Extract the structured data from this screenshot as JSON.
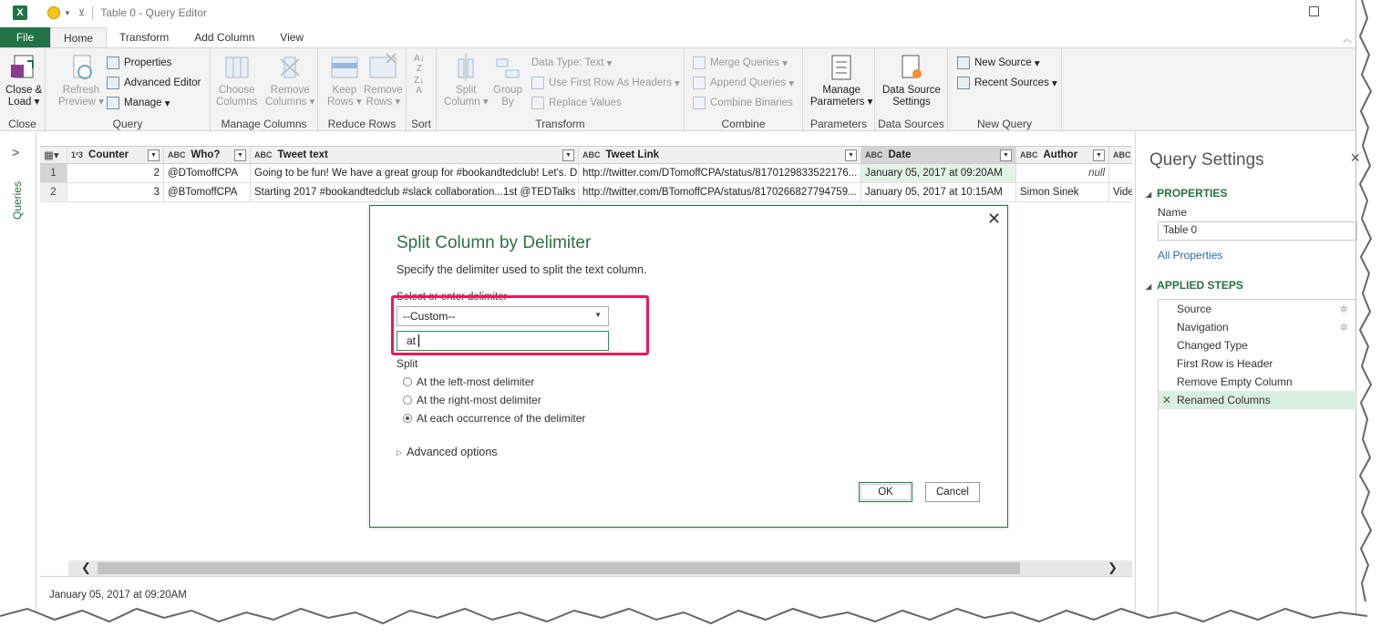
{
  "window": {
    "title": "Table 0 - Query Editor"
  },
  "ribbon_tabs": [
    {
      "label": "File"
    },
    {
      "label": "Home"
    },
    {
      "label": "Transform"
    },
    {
      "label": "Add Column"
    },
    {
      "label": "View"
    }
  ],
  "ribbon": {
    "close": {
      "btn": "Close &",
      "btn2": "Load",
      "label": "Close"
    },
    "query": {
      "refresh": "Refresh",
      "refresh2": "Preview",
      "properties": "Properties",
      "advanced_editor": "Advanced Editor",
      "manage": "Manage",
      "label": "Query"
    },
    "manage_columns": {
      "choose": "Choose",
      "choose2": "Columns",
      "remove": "Remove",
      "remove2": "Columns",
      "label": "Manage Columns"
    },
    "reduce_rows": {
      "keep": "Keep",
      "keep2": "Rows",
      "remove": "Remove",
      "remove2": "Rows",
      "label": "Reduce Rows"
    },
    "sort": {
      "label": "Sort"
    },
    "transform": {
      "split": "Split",
      "split2": "Column",
      "group": "Group",
      "group2": "By",
      "data_type": "Data Type: Text",
      "first_row": "Use First Row As Headers",
      "replace": "Replace Values",
      "label": "Transform"
    },
    "combine": {
      "merge": "Merge Queries",
      "append": "Append Queries",
      "binaries": "Combine Binaries",
      "label": "Combine"
    },
    "parameters": {
      "manage": "Manage",
      "manage2": "Parameters",
      "label": "Parameters"
    },
    "data_sources": {
      "btn": "Data Source",
      "btn2": "Settings",
      "label": "Data Sources"
    },
    "new_query": {
      "new_source": "New Source",
      "recent": "Recent Sources",
      "label": "New Query"
    }
  },
  "queries_pane": {
    "label": "Queries"
  },
  "grid": {
    "columns": [
      {
        "type": "1²3",
        "name": "Counter"
      },
      {
        "type": "ABC",
        "name": "Who?"
      },
      {
        "type": "ABC",
        "name": "Tweet text"
      },
      {
        "type": "ABC",
        "name": "Tweet Link"
      },
      {
        "type": "ABC",
        "name": "Date"
      },
      {
        "type": "ABC",
        "name": "Author"
      },
      {
        "type": "ABC",
        "name": ""
      }
    ],
    "rows": [
      {
        "n": "1",
        "counter": "2",
        "who": "@DTomoffCPA",
        "text": "Going to be fun! We have a great group for #bookandtedclub! Let's. D...",
        "link": "http://twitter.com/DTomoffCPA/status/8170129833522176...",
        "date": "January 05, 2017 at 09:20AM",
        "author": "null",
        "extra": ""
      },
      {
        "n": "2",
        "counter": "3",
        "who": "@BTomoffCPA",
        "text": "Starting 2017 #bookandtedclub #slack collaboration...1st @TEDTalks ...",
        "link": "http://twitter.com/BTomoffCPA/status/8170266827794759...",
        "date": "January 05, 2017 at 10:15AM",
        "author": "Simon Sinek",
        "extra": "Vide"
      }
    ]
  },
  "status": {
    "text": "January 05, 2017 at 09:20AM"
  },
  "query_settings": {
    "title": "Query Settings",
    "properties_heading": "PROPERTIES",
    "name_label": "Name",
    "name_value": "Table 0",
    "all_properties": "All Properties",
    "steps_heading": "APPLIED STEPS",
    "steps": [
      {
        "label": "Source"
      },
      {
        "label": "Navigation"
      },
      {
        "label": "Changed Type"
      },
      {
        "label": "First Row is Header"
      },
      {
        "label": "Remove Empty Column"
      },
      {
        "label": "Renamed Columns"
      }
    ]
  },
  "dialog": {
    "title": "Split Column by Delimiter",
    "description": "Specify the delimiter used to split the text column.",
    "delimiter_label": "Select or enter delimiter",
    "delimiter_selected": "--Custom--",
    "custom_value": "at",
    "split_label": "Split",
    "options": [
      {
        "label": "At the left-most delimiter",
        "selected": false
      },
      {
        "label": "At the right-most delimiter",
        "selected": false
      },
      {
        "label": "At each occurrence of the delimiter",
        "selected": true
      }
    ],
    "advanced": "Advanced options",
    "ok": "OK",
    "cancel": "Cancel"
  },
  "colors": {
    "excel_green": "#217346",
    "highlight": "#e8195a",
    "selected_cell": "#e3f2e6"
  }
}
